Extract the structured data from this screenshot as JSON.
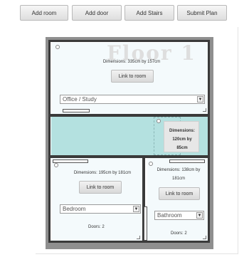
{
  "toolbar": {
    "add_room": "Add room",
    "add_door": "Add door",
    "add_stairs": "Add Stairs",
    "submit_plan": "Submit Plan"
  },
  "plan": {
    "floor_title": "Floor 1",
    "colors": {
      "stairs": "#b4e1e0",
      "wall": "#3a3a3a",
      "frame": "#8f8f8f"
    }
  },
  "rooms": {
    "top": {
      "dimensions": "Dimensions: 335cm by 157cm",
      "link_button": "Link to room",
      "type": "Office / Study"
    },
    "bottom_left": {
      "dimensions": "Dimensions: 195cm by 181cm",
      "link_button": "Link to room",
      "type": "Bedroom",
      "doors": "Doors: 2"
    },
    "bottom_right": {
      "dimensions_line1": "Dimensions: 138cm by",
      "dimensions_line2": "181cm",
      "link_button": "Link to room",
      "type": "Bathroom",
      "doors": "Doors: 2"
    }
  },
  "stairs": {
    "line1": "Dimensions:",
    "line2": "120cm by",
    "line3": "85cm"
  }
}
